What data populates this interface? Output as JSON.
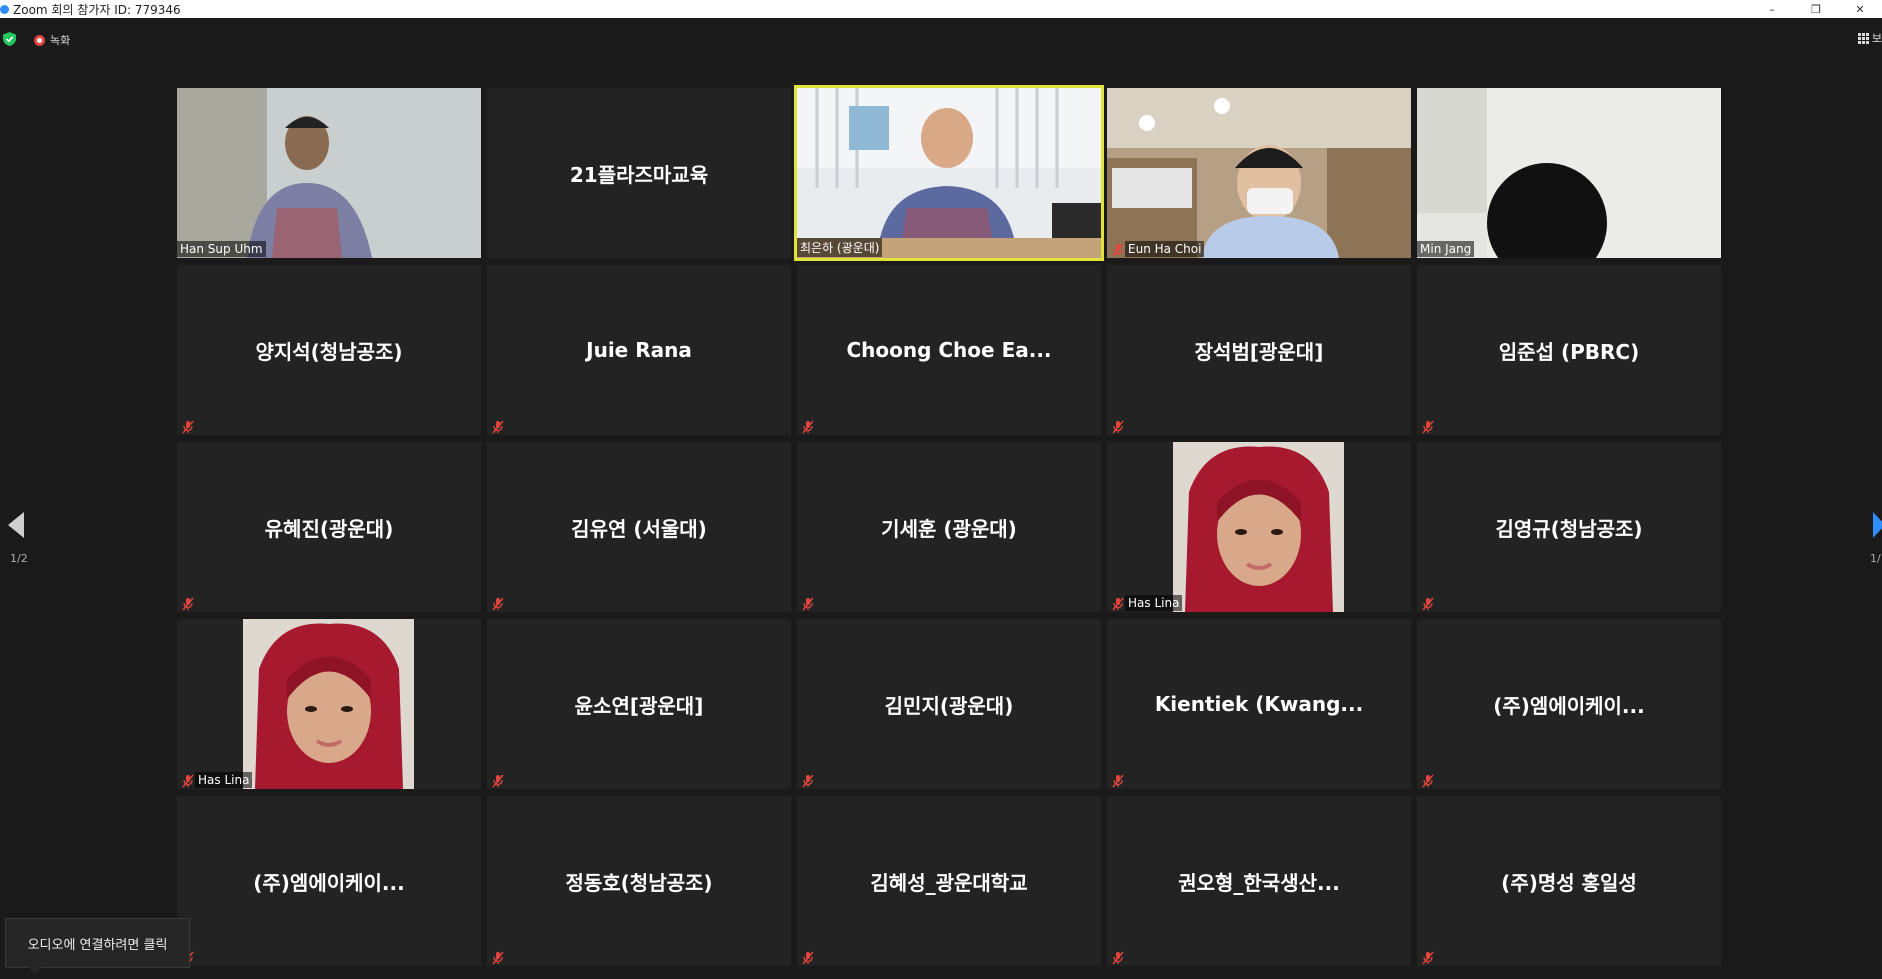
{
  "window": {
    "title": "Zoom 회의 참가자 ID: 779346",
    "minimize": "–",
    "restore": "❐",
    "close": "✕"
  },
  "toolbar": {
    "record_label": "녹화",
    "view_label": "보"
  },
  "navigation": {
    "page_left": "1/2",
    "page_right": "1/"
  },
  "audio_tooltip": "오디오에 연결하려면 클릭",
  "colors": {
    "active_speaker_border": "#dfe33a",
    "muted_icon": "#e0463e",
    "next_arrow": "#2d8cff"
  },
  "participants": [
    {
      "name": "Han Sup Uhm",
      "video": true,
      "muted": false
    },
    {
      "name": "21플라즈마교육",
      "video": false,
      "muted": false
    },
    {
      "name": "최은하 (광운대)",
      "video": true,
      "muted": false,
      "active": true
    },
    {
      "name": "Eun Ha Choi",
      "video": true,
      "muted": true
    },
    {
      "name": "Min Jang",
      "video": true,
      "muted": false
    },
    {
      "name": "양지석(청남공조)",
      "video": false,
      "muted": true
    },
    {
      "name": "Juie Rana",
      "video": false,
      "muted": true
    },
    {
      "name": "Choong  Choe  Ea...",
      "video": false,
      "muted": true
    },
    {
      "name": "장석범[광운대]",
      "video": false,
      "muted": true
    },
    {
      "name": "임준섭 (PBRC)",
      "video": false,
      "muted": true
    },
    {
      "name": "유혜진(광운대)",
      "video": false,
      "muted": true
    },
    {
      "name": "김유연 (서울대)",
      "video": false,
      "muted": true
    },
    {
      "name": "기세훈 (광운대)",
      "video": false,
      "muted": true
    },
    {
      "name": "Has Lina",
      "video": true,
      "muted": true
    },
    {
      "name": "김영규(청남공조)",
      "video": false,
      "muted": true
    },
    {
      "name": "Has Lina",
      "video": true,
      "muted": true
    },
    {
      "name": "윤소연[광운대]",
      "video": false,
      "muted": true
    },
    {
      "name": "김민지(광운대)",
      "video": false,
      "muted": true
    },
    {
      "name": "Kientiek  (Kwang...",
      "video": false,
      "muted": true
    },
    {
      "name": "(주)엠에이케이...",
      "video": false,
      "muted": true
    },
    {
      "name": "(주)엠에이케이...",
      "video": false,
      "muted": true
    },
    {
      "name": "정동호(청남공조)",
      "video": false,
      "muted": true
    },
    {
      "name": "김혜성_광운대학교",
      "video": false,
      "muted": true
    },
    {
      "name": "권오형_한국생산...",
      "video": false,
      "muted": true
    },
    {
      "name": "(주)명성 홍일성",
      "video": false,
      "muted": true
    }
  ]
}
